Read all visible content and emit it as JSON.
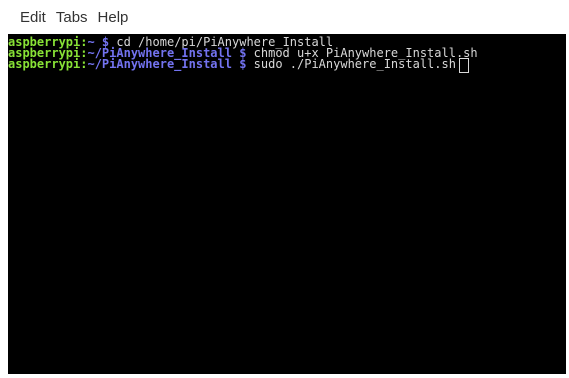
{
  "menubar": {
    "items": [
      {
        "label": "Edit"
      },
      {
        "label": "Tabs"
      },
      {
        "label": "Help"
      }
    ]
  },
  "terminal": {
    "lines": [
      {
        "host": "aspberrypi:",
        "path": "~ $",
        "command": " cd /home/pi/PiAnywhere_Install"
      },
      {
        "host": "aspberrypi:",
        "path": "~/PiAnywhere_Install $",
        "command": " chmod u+x PiAnywhere_Install.sh"
      },
      {
        "host": "aspberrypi:",
        "path": "~/PiAnywhere_Install $",
        "command": " sudo ./PiAnywhere_Install.sh"
      }
    ]
  },
  "colors": {
    "prompt_host": "#88e236",
    "prompt_path": "#7373f0",
    "command_text": "#d8d8d8",
    "terminal_bg": "#000000"
  }
}
